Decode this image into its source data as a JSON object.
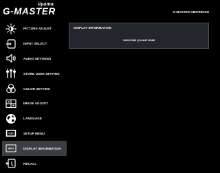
{
  "header": {
    "brand_small": "iiyama",
    "brand_logo": "G-MASTER",
    "model": "G-MASTER GB2790HSU"
  },
  "sidebar": {
    "items": [
      {
        "label": "PICTURE ADJUST",
        "icon": "picture-adjust-icon"
      },
      {
        "label": "INPUT SELECT",
        "icon": "input-select-icon"
      },
      {
        "label": "AUDIO SETTINGS",
        "icon": "speaker-icon"
      },
      {
        "label": "STORE USER SETTING",
        "icon": "sliders-icon"
      },
      {
        "label": "COLOR SETTING",
        "icon": "color-circles-icon"
      },
      {
        "label": "IMAGE ADJUST",
        "icon": "image-adjust-icon"
      },
      {
        "label": "LANGUAGE",
        "icon": "globe-icon"
      },
      {
        "label": "SETUP MENU",
        "icon": "setup-menu-icon"
      },
      {
        "label": "DISPLAY INFORMATION",
        "icon": "display-info-icon"
      },
      {
        "label": "RECALL",
        "icon": "recall-icon"
      }
    ],
    "active_index": 8
  },
  "panel": {
    "title": "DISPLAY INFORMATION",
    "value": "1920X1080 @144HZ HDMI"
  },
  "colors": {
    "background": "#000000",
    "panel_bg": "#23272d",
    "selected_bg": "#3a3f46",
    "text": "#ffffff"
  }
}
